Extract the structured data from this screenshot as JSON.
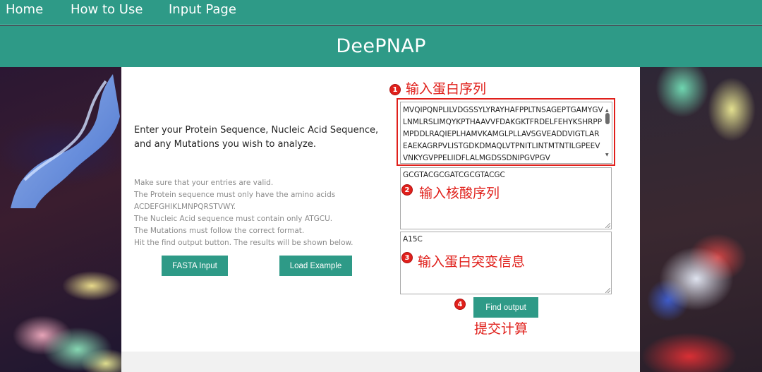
{
  "nav": {
    "home": "Home",
    "how_to_use": "How to Use",
    "input_page": "Input Page"
  },
  "header": {
    "title": "DeePNAP"
  },
  "main": {
    "intro": "Enter your Protein Sequence, Nucleic Acid Sequence, and any Mutations you wish to analyze.",
    "rules": [
      "Make sure that your entries are valid.",
      "The Protein sequence must only have the amino acids",
      "ACDEFGHIKLMNPQRSTVWY.",
      "The Nucleic Acid sequence must contain only ATGCU.",
      "The Mutations must follow the correct format.",
      "Hit the find output button. The results will be shown below."
    ],
    "fasta_button": "FASTA Input",
    "load_example_button": "Load Example",
    "find_output_button": "Find output"
  },
  "inputs": {
    "protein_sequence": "MVQIPQNPLILVDGSSYLYRAYHAFPPLTNSAGEPTGAMYGVLNMLRSLIMQYKPTHAAVVFDAKGKTFRDELFEHYKSHRPPMPDDLRAQIEPLHAMVKAMGLPLLAVSGVEADDVIGTLAREAEKAGRPVLISTGDKDMAQLVTPNITLINTMTNTILGPEEVVNKYGVPPELIIDFLALMGDSSDNIPGVPGV",
    "nucleic_sequence": "GCGTACGCGATCGCGTACGC",
    "mutations": "A15C"
  },
  "annotations": {
    "step1_number": "1",
    "step1": "输入蛋白序列",
    "step2_number": "2",
    "step2": "输入核酸序列",
    "step3_number": "3",
    "step3": "输入蛋白突变信息",
    "step4_number": "4",
    "step4": "提交计算"
  },
  "colors": {
    "brand_teal": "#2e9a87",
    "annotation_red": "#e0201b"
  }
}
